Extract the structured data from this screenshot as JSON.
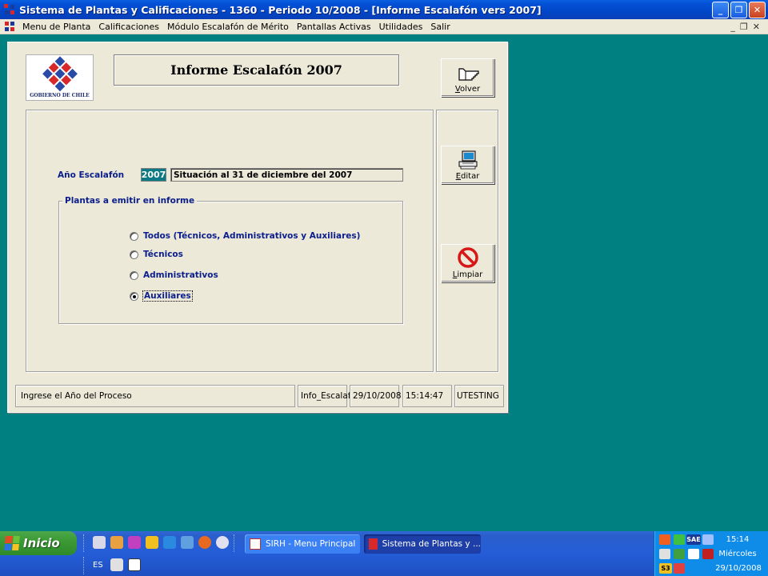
{
  "window": {
    "title": "Sistema de Plantas y Calificaciones - 1360 - Periodo 10/2008 - [Informe Escalafón vers 2007]",
    "buttons": {
      "minimize": "_",
      "restore": "❐",
      "close": "✕"
    }
  },
  "menubar": {
    "items": [
      "Menu de Planta",
      "Calificaciones",
      "Módulo Escalafón de Mérito",
      "Pantallas Activas",
      "Utilidades",
      "Salir"
    ],
    "mdi_buttons": [
      "_",
      "❐",
      "✕"
    ]
  },
  "form": {
    "logo_caption": "GOBIERNO DE CHILE",
    "title": "Informe Escalafón 2007",
    "buttons": {
      "volver": {
        "accel": "V",
        "rest": "olver"
      },
      "editar": {
        "accel": "E",
        "rest": "ditar"
      },
      "limpiar": {
        "accel": "L",
        "rest": "impiar"
      }
    },
    "anio_label": "Año Escalafón",
    "anio_value": "2007",
    "situacion": "Situación al 31 de diciembre del 2007",
    "group_title": "Plantas a emitir en informe",
    "options": [
      {
        "label": "Todos (Técnicos, Administrativos y Auxiliares)",
        "selected": false
      },
      {
        "label": "Técnicos",
        "selected": false
      },
      {
        "label": "Administrativos",
        "selected": false
      },
      {
        "label": "Auxiliares",
        "selected": true
      }
    ]
  },
  "statusbar": {
    "message": "Ingrese el Año del Proceso",
    "form_name": "Info_Escalaf",
    "date": "29/10/2008",
    "time": "15:14:47",
    "user": "UTESTING"
  },
  "taskbar": {
    "start_label": "Inicio",
    "language": "ES",
    "tasks": [
      "SIRH - Menu Principal",
      "Sistema de Plantas y ..."
    ],
    "tray": {
      "sae": "SAE",
      "s3": "S3",
      "time": "15:14",
      "day": "Miércoles",
      "date": "29/10/2008"
    }
  },
  "colors": {
    "desktop": "#008080",
    "form_bg": "#ece9d8",
    "label_blue": "#0b1e8c",
    "year_box": "#0b7a84"
  }
}
